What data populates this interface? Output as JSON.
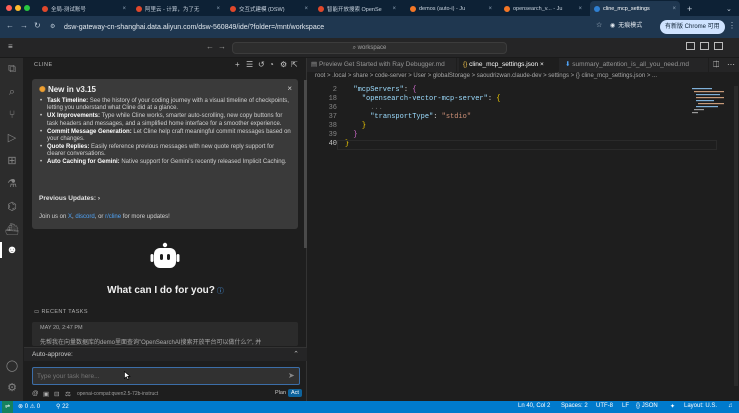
{
  "browser": {
    "tabs": [
      {
        "label": "全局-测试账号"
      },
      {
        "label": "阿里云 - 计算，为了无"
      },
      {
        "label": "交互式建模 (DSW)"
      },
      {
        "label": "智能开放搜索 OpenSe"
      },
      {
        "label": "demos (auto-i) - Ju"
      },
      {
        "label": "opensearch_v... - Ju"
      },
      {
        "label": "cline_mcp_settings"
      }
    ],
    "new_tab": "+",
    "url": "dsw-gateway-cn-shanghai.data.aliyun.com/dsw-560849/ide/?folder=/mnt/workspace",
    "incognito_label": "无痕模式",
    "new_chrome_label": "有新版 Chrome 可用"
  },
  "vscode": {
    "command_center": "workspace",
    "cline": {
      "panel_title": "CLINE",
      "announcement": {
        "title": "New in v3.15",
        "items": [
          {
            "bold": "Task Timeline:",
            "text": " See the history of your coding journey with a visual timeline of checkpoints, letting you understand what Cline did at a glance."
          },
          {
            "bold": "UX Improvements:",
            "text": " Type while Cline works, smarter auto-scrolling, new copy buttons for task headers and messages, and a simplified home interface for a smoother experience."
          },
          {
            "bold": "Commit Message Generation:",
            "text": " Let Cline help craft meaningful commit messages based on your changes."
          },
          {
            "bold": "Quote Replies:",
            "text": " Easily reference previous messages with new quote reply support for clearer conversations."
          },
          {
            "bold": "Auto Caching for Gemini:",
            "text": " Native support for Gemini's recently released Implicit Caching."
          }
        ],
        "previous_updates": "Previous Updates:",
        "join_prefix": "Join us on ",
        "join_x": "X",
        "join_discord": "discord",
        "join_or": ", or ",
        "join_reddit": "r/cline",
        "join_suffix": " for more updates!"
      },
      "help_heading": "What can I do for you?",
      "recent_tasks_label": "RECENT TASKS",
      "recent_task": {
        "date": "MAY 20, 2:47 PM",
        "text": "先帮我在向量数据库的demo里面查询\"OpenSearchAI搜索开放平台可以做什么?\", 并"
      },
      "auto_approve_label": "Auto-approve:",
      "input_placeholder": "Type your task here...",
      "model_name": "openai-compat:qwen2.5-72b-instruct",
      "plan_label": "Plan",
      "act_label": "Act"
    },
    "editor": {
      "tabs": [
        {
          "label": "Preview Get Started with Ray Debugger.md"
        },
        {
          "label": "cline_mcp_settings.json"
        },
        {
          "label": "summary_attention_is_all_you_need.md"
        }
      ],
      "breadcrumb": "root > .local > share > code-server > User > globalStorage > saoudrizwan.claude-dev > settings > {} cline_mcp_settings.json > ...",
      "line_numbers": [
        "2",
        "18",
        "36",
        "37",
        "38",
        "39",
        "40"
      ],
      "code": {
        "line2_key": "\"mcpServers\"",
        "line18_key": "\"opensearch-vector-mcp-server\"",
        "line37_key": "\"transportType\"",
        "line37_val": "\"stdio\""
      }
    },
    "status_bar": {
      "errors": "0",
      "warnings": "0",
      "ports": "22",
      "position": "Ln 40, Col 2",
      "spaces": "Spaces: 2",
      "encoding": "UTF-8",
      "eol": "LF",
      "language": "JSON",
      "layout": "Layout: U.S."
    }
  },
  "colors": {
    "chrome_dark": "#0d2135",
    "accent": "#007acc",
    "link": "#4fa3f7"
  }
}
